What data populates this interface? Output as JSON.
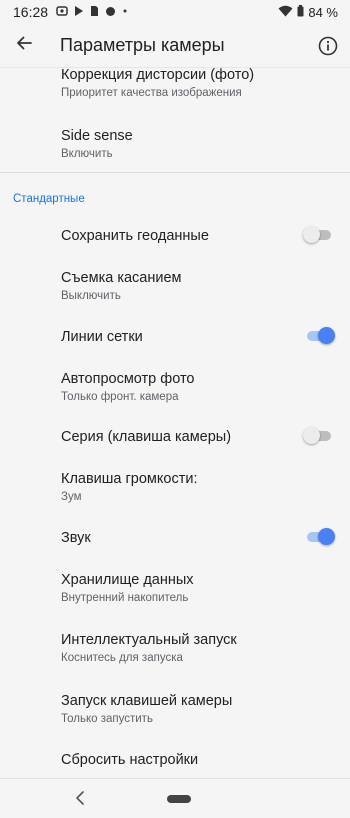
{
  "status": {
    "time": "16:28",
    "battery": "84 %"
  },
  "appbar": {
    "title": "Параметры камеры"
  },
  "items_top": [
    {
      "title": "Коррекция дисторсии (фото)",
      "subtitle": "Приоритет качества изображения"
    },
    {
      "title": "Side sense",
      "subtitle": "Включить"
    }
  ],
  "section": {
    "label": "Стандартные"
  },
  "items": [
    {
      "title": "Сохранить геоданные",
      "toggle": "off"
    },
    {
      "title": "Съемка касанием",
      "subtitle": "Выключить"
    },
    {
      "title": "Линии сетки",
      "toggle": "on"
    },
    {
      "title": "Автопросмотр фото",
      "subtitle": "Только фронт. камера"
    },
    {
      "title": "Серия (клавиша камеры)",
      "toggle": "off"
    },
    {
      "title": "Клавиша громкости:",
      "subtitle": "Зум"
    },
    {
      "title": "Звук",
      "toggle": "on"
    },
    {
      "title": "Хранилище данных",
      "subtitle": "Внутренний накопитель"
    },
    {
      "title": "Интеллектуальный запуск",
      "subtitle": "Коснитесь для запуска"
    },
    {
      "title": "Запуск клавишей камеры",
      "subtitle": "Только запустить"
    },
    {
      "title": "Сбросить настройки"
    }
  ],
  "colors": {
    "accent": "#1a73e8",
    "toggle_on": "#4a80f5"
  },
  "icons": {
    "back": "arrow-left-icon",
    "info": "info-icon",
    "nav_back": "chevron-left-icon",
    "nav_home": "home-pill-icon"
  }
}
